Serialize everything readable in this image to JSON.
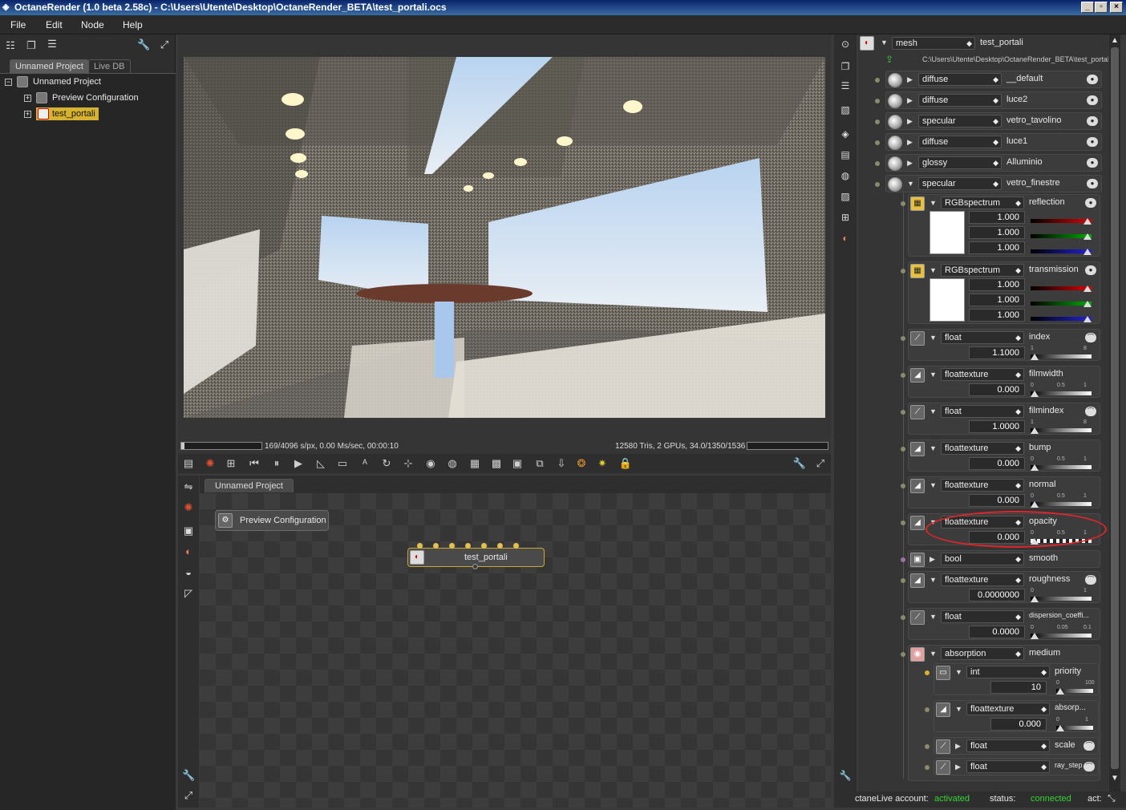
{
  "window": {
    "title": "OctaneRender (1.0 beta 2.58c) - C:\\Users\\Utente\\Desktop\\OctaneRender_BETA\\test_portali.ocs",
    "minimize": "_",
    "maximize": "▫",
    "close": "×"
  },
  "menu": {
    "file": "File",
    "edit": "Edit",
    "node": "Node",
    "help": "Help"
  },
  "left_panel": {
    "tabs": [
      "Unnamed Project",
      "Live DB"
    ],
    "tree": {
      "root": "Unnamed Project",
      "items": [
        "Preview Configuration",
        "test_portali"
      ]
    }
  },
  "render": {
    "progress_text": "169/4096 s/px, 0.00 Ms/sec, 00:00:10",
    "stats_text": "12580 Tris, 2 GPUs, 34.0/1350/1536 MB",
    "progress": 0.04
  },
  "node_editor": {
    "tab": "Unnamed Project",
    "preview_node": "Preview Configuration",
    "mesh_node": "test_portali"
  },
  "inspector": {
    "mesh_type": "mesh",
    "mesh_name": "test_portali",
    "mesh_path": "C:\\Users\\Utente\\Desktop\\OctaneRender_BETA\\test_portali.obj",
    "materials": [
      {
        "type": "diffuse",
        "name": "__default"
      },
      {
        "type": "diffuse",
        "name": "luce2"
      },
      {
        "type": "specular",
        "name": "vetro_tavolino"
      },
      {
        "type": "diffuse",
        "name": "luce1"
      },
      {
        "type": "glossy",
        "name": "Alluminio"
      },
      {
        "type": "specular",
        "name": "vetro_finestre"
      }
    ],
    "reflection": {
      "type": "RGBspectrum",
      "name": "reflection",
      "values": [
        "1.000",
        "1.000",
        "1.000"
      ]
    },
    "transmission": {
      "type": "RGBspectrum",
      "name": "transmission",
      "values": [
        "1.000",
        "1.000",
        "1.000"
      ]
    },
    "params": [
      {
        "type": "float",
        "name": "index",
        "value": "1.1000",
        "ticks": [
          "1",
          "",
          "8"
        ]
      },
      {
        "type": "floattexture",
        "name": "filmwidth",
        "value": "0.000",
        "ticks": [
          "0",
          "0.5",
          "1"
        ]
      },
      {
        "type": "float",
        "name": "filmindex",
        "value": "1.0000",
        "ticks": [
          "1",
          "",
          "8"
        ]
      },
      {
        "type": "floattexture",
        "name": "bump",
        "value": "0.000",
        "ticks": [
          "0",
          "0.5",
          "1"
        ]
      },
      {
        "type": "floattexture",
        "name": "normal",
        "value": "0.000",
        "ticks": [
          "0",
          "0.5",
          "1"
        ]
      },
      {
        "type": "floattexture",
        "name": "opacity",
        "value": "0.000",
        "ticks": [
          "0",
          "0.5",
          "1"
        ]
      }
    ],
    "smooth": {
      "type": "bool",
      "name": "smooth"
    },
    "roughness": {
      "type": "floattexture",
      "name": "roughness",
      "value": "0.0000000",
      "ticks": [
        "0",
        "",
        "1"
      ]
    },
    "dispersion": {
      "type": "float",
      "name": "dispersion_coeffi...",
      "value": "0.0000",
      "ticks": [
        "0",
        "0.05",
        "0.1"
      ]
    },
    "medium": {
      "type": "absorption",
      "name": "medium"
    },
    "priority": {
      "type": "int",
      "name": "priority",
      "value": "10",
      "ticks": [
        "0",
        "100"
      ]
    },
    "absorption": {
      "type": "floattexture",
      "name": "absorp...",
      "value": "0.000",
      "ticks": [
        "0",
        "1"
      ]
    },
    "scale": {
      "type": "float",
      "name": "scale"
    },
    "ray_step": {
      "type": "float",
      "name": "ray_step"
    }
  },
  "status": {
    "account_label": "ctaneLive account:",
    "account_value": "activated",
    "status_label": "status:",
    "status_value": "connected",
    "act_label": "act:"
  },
  "colors": {
    "highlight": "#d7b230",
    "annotation": "#e0252b",
    "status_green": "#33d633"
  }
}
